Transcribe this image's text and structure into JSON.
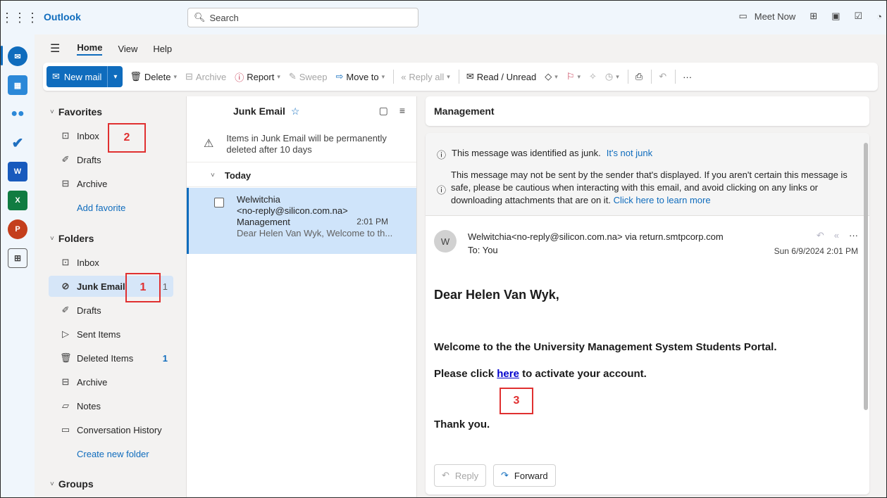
{
  "app": {
    "title": "Outlook"
  },
  "search": {
    "placeholder": "Search"
  },
  "topbar": {
    "meet_now": "Meet Now"
  },
  "ribbon_tabs": [
    "Home",
    "View",
    "Help"
  ],
  "toolbar": {
    "new_mail": "New mail",
    "delete": "Delete",
    "archive": "Archive",
    "report": "Report",
    "sweep": "Sweep",
    "move_to": "Move to",
    "reply_all": "Reply all",
    "read_unread": "Read / Unread",
    "more": "···"
  },
  "folders": {
    "favorites_label": "Favorites",
    "favorites": [
      {
        "label": "Inbox",
        "icon": "inbox-icon"
      },
      {
        "label": "Drafts",
        "icon": "pencil-icon"
      },
      {
        "label": "Archive",
        "icon": "archive-icon"
      }
    ],
    "add_favorite": "Add favorite",
    "folders_label": "Folders",
    "items": [
      {
        "label": "Inbox",
        "icon": "inbox-icon",
        "count": ""
      },
      {
        "label": "Junk Email",
        "icon": "junk-icon",
        "count": "1"
      },
      {
        "label": "Drafts",
        "icon": "pencil-icon",
        "count": ""
      },
      {
        "label": "Sent Items",
        "icon": "send-icon",
        "count": ""
      },
      {
        "label": "Deleted Items",
        "icon": "trash-icon",
        "count": "1"
      },
      {
        "label": "Archive",
        "icon": "archive-icon",
        "count": ""
      },
      {
        "label": "Notes",
        "icon": "note-icon",
        "count": ""
      },
      {
        "label": "Conversation History",
        "icon": "folder-icon",
        "count": ""
      }
    ],
    "create_new_folder": "Create new folder",
    "groups_label": "Groups"
  },
  "list": {
    "title": "Junk Email",
    "junk_notice": "Items in Junk Email will be permanently deleted after 10 days",
    "group": "Today",
    "message": {
      "from_name": "Welwitchia",
      "from_addr": "<no-reply@silicon.com.na>",
      "subject": "Management",
      "time": "2:01 PM",
      "preview": "Dear Helen Van Wyk, Welcome to th..."
    }
  },
  "reading": {
    "subject": "Management",
    "junk_banner": "This message was identified as junk.",
    "not_junk_link": "It's not junk",
    "warning": "This message may not be sent by the sender that's displayed. If you aren't certain this message is safe, please be cautious when interacting with this email, and avoid clicking on any links or downloading attachments that are on it.",
    "learn_more": "Click here to learn more",
    "avatar": "W",
    "sender_line": "Welwitchia<no-reply@silicon.com.na> via return.smtpcorp.com",
    "to_line": "To: You",
    "date": "Sun 6/9/2024 2:01 PM",
    "greeting": "Dear Helen Van Wyk,",
    "para1": "Welcome to the the University Management System Students Portal.",
    "para2_before": "Please click ",
    "para2_link": "here",
    "para2_after": " to activate your account.",
    "closing": "Thank you.",
    "reply": "Reply",
    "forward": "Forward"
  },
  "annotations": [
    "2",
    "1",
    "3"
  ],
  "colors": {
    "accent": "#0f6cbd",
    "selected": "#cfe4fa",
    "annotation": "#e03030"
  }
}
